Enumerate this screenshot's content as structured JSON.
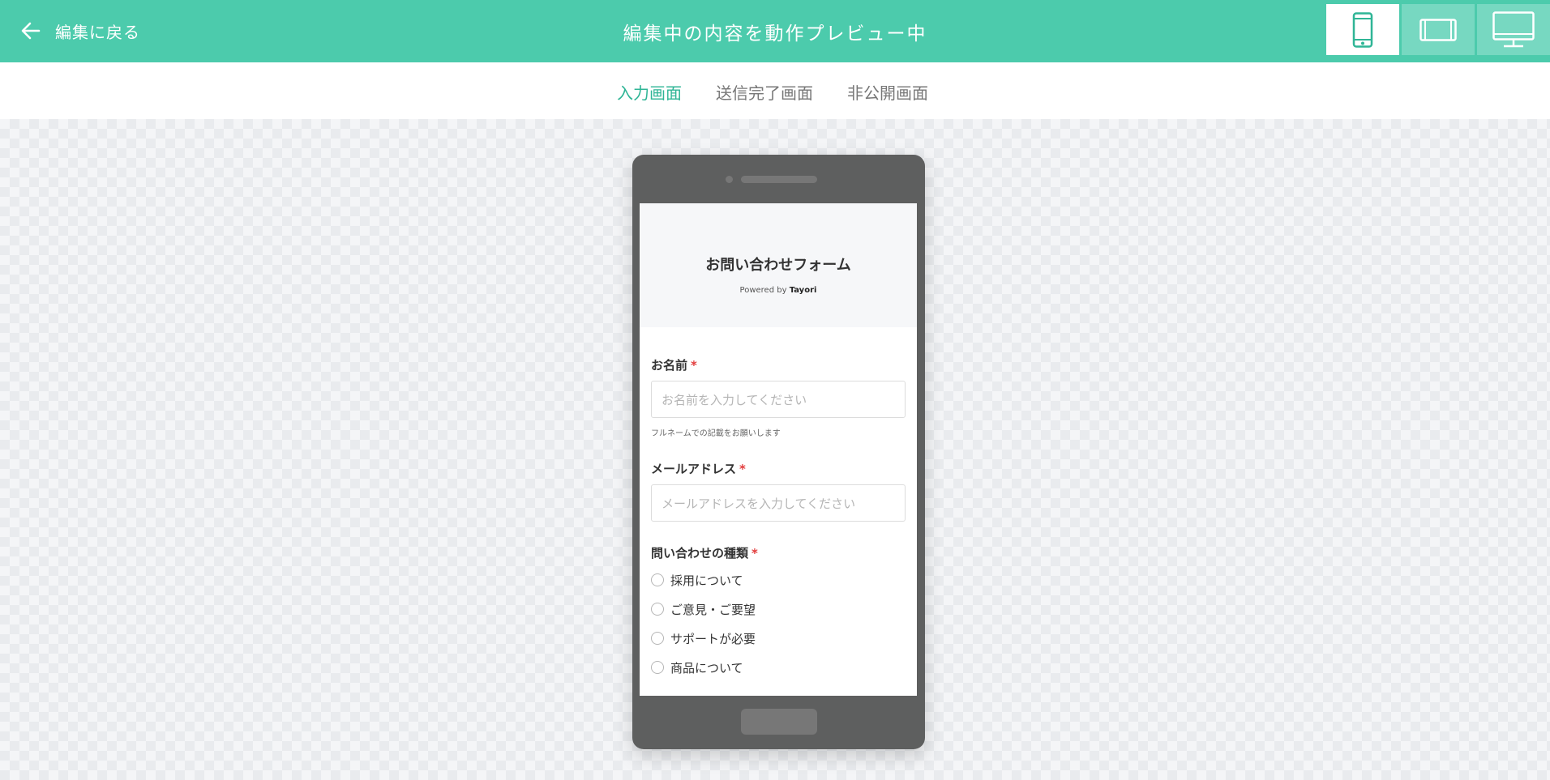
{
  "header": {
    "back_label": "編集に戻る",
    "title": "編集中の内容を動作プレビュー中",
    "devices": [
      {
        "name": "smartphone",
        "icon": "smartphone-icon",
        "active": true
      },
      {
        "name": "tablet",
        "icon": "tablet-icon",
        "active": false
      },
      {
        "name": "desktop",
        "icon": "desktop-icon",
        "active": false
      }
    ]
  },
  "tabs": [
    {
      "label": "入力画面",
      "active": true
    },
    {
      "label": "送信完了画面",
      "active": false
    },
    {
      "label": "非公開画面",
      "active": false
    }
  ],
  "form": {
    "title": "お問い合わせフォーム",
    "powered_prefix": "Powered by",
    "powered_brand": "Tayori",
    "fields": {
      "name": {
        "label": "お名前",
        "required_mark": "*",
        "placeholder": "お名前を入力してください",
        "hint": "フルネームでの記載をお願いします"
      },
      "email": {
        "label": "メールアドレス",
        "required_mark": "*",
        "placeholder": "メールアドレスを入力してください"
      },
      "inquiry_type": {
        "label": "問い合わせの種類",
        "required_mark": "*",
        "options": [
          "採用について",
          "ご意見・ご要望",
          "サポートが必要",
          "商品について"
        ]
      }
    }
  },
  "colors": {
    "brand": "#4ccbac",
    "tab_active": "#2fb596",
    "required": "#e23b3b",
    "phone_body": "#5e5f5f"
  }
}
